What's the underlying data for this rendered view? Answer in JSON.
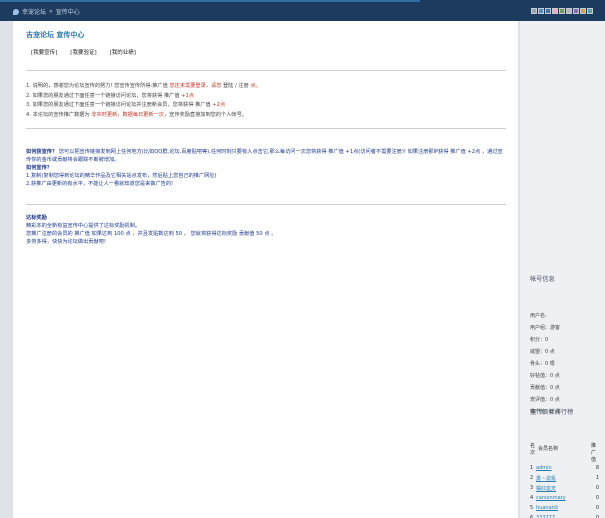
{
  "breadcrumb": {
    "site": "幸宠论坛",
    "sep": "»",
    "page": "宣传中心"
  },
  "header": {
    "title": "吉宠论坛 宣传中心"
  },
  "tabs": [
    "[我要宣传]",
    "[我要验证]",
    "[我的业绩]"
  ],
  "rules": [
    {
      "n": "1.",
      "text": "说明的，感谢您为论坛宣传的努力! 您宣传宣传所得:推广值",
      "hl": "您还未需要登录，请您",
      "tail": "登陆 / 注册",
      "tail2": "点。"
    },
    {
      "n": "2.",
      "text": "如果您的朋友通过下面任意一个链接访问论坛，您将获得 推广值",
      "hl2": "+1点"
    },
    {
      "n": "3.",
      "text": "如果您的朋友通过下面任意一个链接访问论坛并注册新会员，您将获得 推广值",
      "hl2": "+2点"
    },
    {
      "n": "4.",
      "text": "本论坛的宣传推广数据为",
      "hl": "非实时更新，数据每日更新一次",
      "tail": "，宣传奖励直接加到您的个人帐号。"
    }
  ],
  "how": {
    "q1": "如何宣传？",
    "intro_label": "如何获宣传？",
    "intro": "您可以把宣传链接发到网上任何地方(比如QQ群,论坛,百度贴吧等),任何时刻只要有人点击它,那么每访问一次您将获得 推广值 +1点(访问者不需要注册)! 如果注册那IP获得 推广值 +2点 ，通过宣传你的金币或贡献将会跟踪不断被增加。",
    "q2": "如何宣传？",
    "steps": [
      "1.复制(复制您得到论坛的精华作品及它相关站点发布，然后贴上您自己的推广网址)",
      "2.获推广由更新的有水平，不能让人一看就知道您是来做广告的!"
    ]
  },
  "reward": {
    "title": "达标奖励",
    "lines": [
      "精彩本的全新有益宣传中心提供了达标奖励机制。",
      "您推广注册的会员的 推广值 如果达到 100 点 ，并且发贴数达到 50 。 您就将获得达标奖励 贡献值 50 点 。",
      "多劳多得，快快为论坛做出贡献吧!"
    ]
  },
  "account": {
    "title": "帐号信息",
    "rows": [
      "用户名:",
      "用户组：游客",
      "积分：0",
      "威望：0 点",
      "骨头：0 根",
      "好帖值：0 点",
      "贡献值：0 点",
      "宠评值：0 点",
      "推广值：0 点"
    ]
  },
  "ranking": {
    "title": "宣传贡献排行榜",
    "col_rank": "名次",
    "col_name": "会员名称",
    "col_val": "推广值",
    "rows": [
      {
        "rank": "1",
        "name": "admin",
        "val": "8"
      },
      {
        "rank": "2",
        "name": "勇丶渝氪",
        "val": "1"
      },
      {
        "rank": "3",
        "name": "橘红蓝天",
        "val": "0"
      },
      {
        "rank": "4",
        "name": "carsonmary",
        "val": "0"
      },
      {
        "rank": "5",
        "name": "huananit",
        "val": "0"
      },
      {
        "rank": "6",
        "name": "333777",
        "val": "0"
      }
    ]
  },
  "colors": {
    "topbar": "#1d3b5e",
    "link": "#2f78a8",
    "highlight": "#c0392b",
    "green": "#2e8b57",
    "navy": "#1e3a8a"
  }
}
